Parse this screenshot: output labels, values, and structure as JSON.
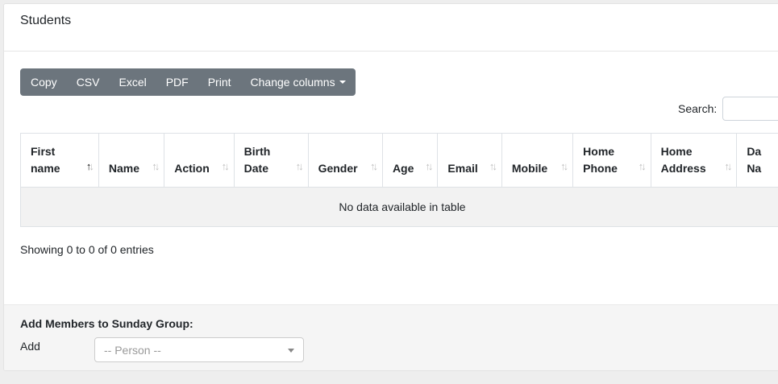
{
  "card": {
    "title": "Students"
  },
  "toolbar": {
    "buttons": [
      "Copy",
      "CSV",
      "Excel",
      "PDF",
      "Print",
      "Change columns"
    ]
  },
  "search": {
    "label": "Search:",
    "value": ""
  },
  "table": {
    "headers": [
      [
        "First",
        "name"
      ],
      [
        "Name"
      ],
      [
        "Action"
      ],
      [
        "Birth",
        "Date"
      ],
      [
        "Gender"
      ],
      [
        "Age"
      ],
      [
        "Email"
      ],
      [
        "Mobile"
      ],
      [
        "Home",
        "Phone"
      ],
      [
        "Home",
        "Address"
      ],
      [
        "Da",
        "Na"
      ]
    ],
    "empty_message": "No data available in table"
  },
  "info": "Showing 0 to 0 of 0 entries",
  "add_members": {
    "title": "Add Members to Sunday Group:",
    "add_label": "Add",
    "person_placeholder": "-- Person --"
  }
}
